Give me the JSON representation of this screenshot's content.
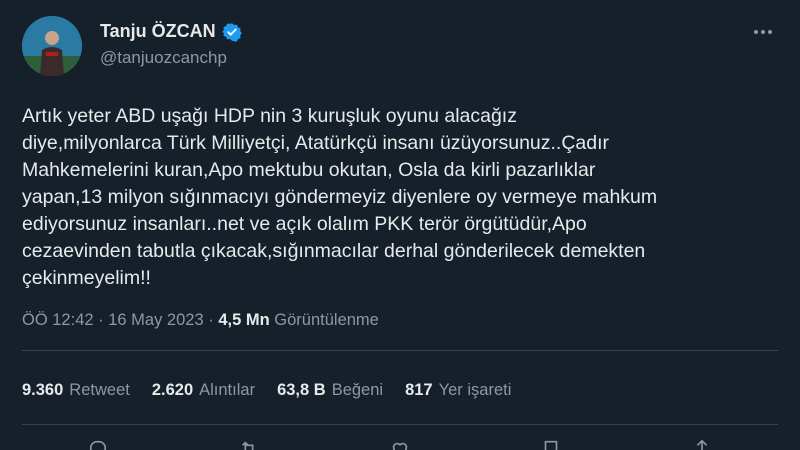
{
  "author": {
    "display_name": "Tanju ÖZCAN",
    "handle": "@tanjuozcanchp"
  },
  "tweet": {
    "text": "Artık yeter ABD uşağı HDP nin 3 kuruşluk oyunu alacağız\ndiye,milyonlarca Türk Milliyetçi, Atatürkçü insanı üzüyorsunuz..Çadır\nMahkemelerini kuran,Apo mektubu okutan, Osla da kirli pazarlıklar\nyapan,13 milyon sığınmacıyı göndermeyiz diyenlere oy vermeye mahkum\nediyorsunuz insanları..net ve açık olalım PKK terör örgütüdür,Apo\ncezaevinden tabutla çıkacak,sığınmacılar derhal gönderilecek demekten\nçekinmeyelim!!"
  },
  "meta": {
    "time": "ÖÖ 12:42",
    "separator": "·",
    "date": "16 May 2023",
    "views_count": "4,5 Mn",
    "views_label": "Görüntülenme"
  },
  "stats": [
    {
      "count": "9.360",
      "label": "Retweet"
    },
    {
      "count": "2.620",
      "label": "Alıntılar"
    },
    {
      "count": "63,8 B",
      "label": "Beğeni"
    },
    {
      "count": "817",
      "label": "Yer işareti"
    }
  ],
  "icons": {
    "verified": "verified-badge-icon",
    "more": "more-options-icon",
    "actions": [
      "reply-icon",
      "retweet-icon",
      "like-icon",
      "bookmark-icon",
      "share-icon"
    ]
  },
  "colors": {
    "background": "#15202b",
    "text": "#e7e9ea",
    "secondary": "#8b98a5",
    "verified": "#1d9bf0",
    "divider": "#38444d"
  }
}
